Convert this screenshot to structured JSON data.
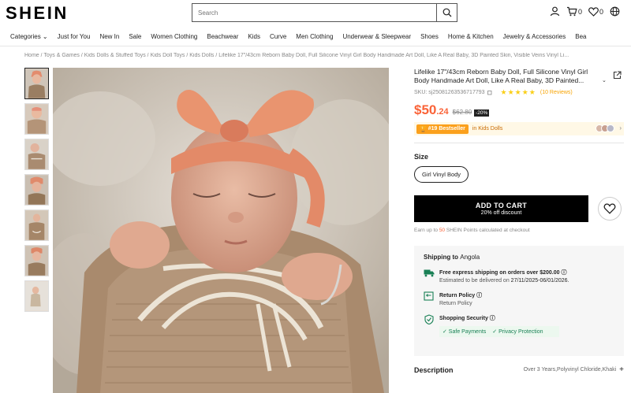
{
  "header": {
    "logo": "SHEIN",
    "search_placeholder": "Search",
    "cart_count": "0",
    "wishlist_count": "0"
  },
  "nav": {
    "items": [
      "Categories",
      "Just for You",
      "New In",
      "Sale",
      "Women Clothing",
      "Beachwear",
      "Kids",
      "Curve",
      "Men Clothing",
      "Underwear & Sleepwear",
      "Shoes",
      "Home & Kitchen",
      "Jewelry & Accessories",
      "Bea"
    ]
  },
  "breadcrumb": {
    "items": [
      "Home",
      "Toys & Games",
      "Kids Dolls & Stuffed Toys",
      "Kids Doll Toys",
      "Kids Dolls",
      "Lifelike 17\"/43cm Reborn Baby Doll, Full Silicone Vinyl Girl Body Handmade Art Doll, Like A Real Baby, 3D Painted Skin, Visible Veins Vinyl Li..."
    ]
  },
  "product": {
    "title": "Lifelike 17\"/43cm Reborn Baby Doll, Full Silicone Vinyl Girl Body Handmade Art Doll, Like A Real Baby, 3D Painted...",
    "sku": "SKU: sj25081263536717793",
    "stars": "★★★★★",
    "reviews": "(10 Reviews)",
    "rating": 5,
    "price_main": "$50",
    "price_cents": ".24",
    "price_old": "$62.80",
    "discount": "-20%",
    "bestseller": "#19 Bestseller",
    "bestseller_cat": "in Kids Dolls",
    "size_label": "Size",
    "size_option": "Girl Vinyl Body",
    "cart_label": "ADD TO CART",
    "cart_sub": "20% off discount",
    "points_pre": "Earn up to ",
    "points_val": "50",
    "points_post": " SHEIN Points calculated at checkout"
  },
  "shipping": {
    "title": "Shipping to",
    "dest": "Angola",
    "free_title": "Free express shipping on orders over $200.00",
    "free_sub_pre": "Estimated to be delivered on ",
    "free_sub_date": "27/11/2025-06/01/2026.",
    "return_title": "Return Policy",
    "return_sub": "Return Policy",
    "security_title": "Shopping Security",
    "security_tags": [
      "✓ Safe Payments",
      "✓ Privacy Protection"
    ]
  },
  "description": {
    "title": "Description",
    "value": "Over 3 Years,Polyvinyl Chloride,Khaki"
  },
  "colors": {
    "price": "#fa6338",
    "star": "#facf19",
    "bestseller": "#fba01c",
    "security_green": "#198055"
  }
}
